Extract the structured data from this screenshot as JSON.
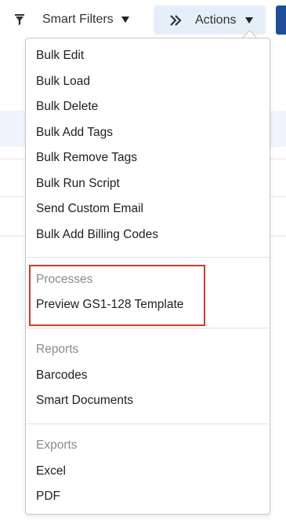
{
  "toolbar": {
    "filter_label": "Smart Filters",
    "filter_icon": "filter-icon",
    "actions_label": "Actions",
    "actions_icon": "double-chevron-right-icon",
    "actions_bg": "#e6eff9",
    "primary_color": "#1f4f9c"
  },
  "menu": {
    "bulk_items": [
      "Bulk Edit",
      "Bulk Load",
      "Bulk Delete",
      "Bulk Add Tags",
      "Bulk Remove Tags",
      "Bulk Run Script",
      "Send Custom Email",
      "Bulk Add Billing Codes"
    ],
    "sections": {
      "processes": {
        "heading": "Processes",
        "items": [
          "Preview GS1-128 Template"
        ]
      },
      "reports": {
        "heading": "Reports",
        "items": [
          "Barcodes",
          "Smart Documents"
        ]
      },
      "exports": {
        "heading": "Exports",
        "items": [
          "Excel",
          "PDF"
        ]
      }
    },
    "highlight_color": "#d23a25"
  }
}
